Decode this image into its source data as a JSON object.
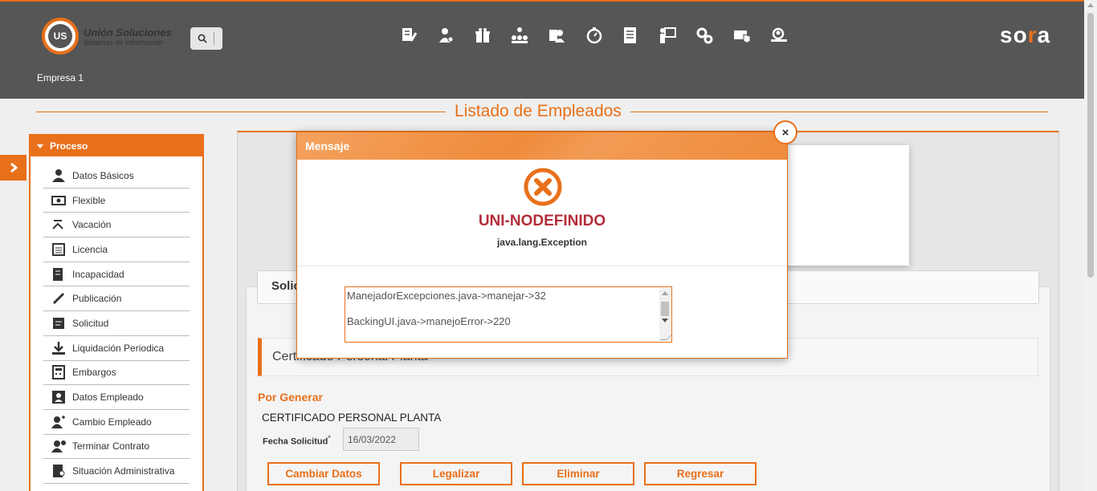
{
  "header": {
    "logo_title": "Unión Soluciones",
    "logo_subtitle": "Sistemas de Información",
    "logo_mark": "US",
    "brand": "sora",
    "empresa": "Empresa 1",
    "nav_icons": [
      "document-edit-icon",
      "user-money-icon",
      "gift-icon",
      "org-chart-icon",
      "user-badge-icon",
      "stopwatch-icon",
      "document-list-icon",
      "presentation-icon",
      "gears-icon",
      "shield-check-icon",
      "user-search-icon"
    ]
  },
  "page": {
    "title": "Listado de Empleados"
  },
  "sidebar": {
    "header": "Proceso",
    "items": [
      {
        "label": "Datos Básicos",
        "icon": "user-icon"
      },
      {
        "label": "Flexible",
        "icon": "money-icon"
      },
      {
        "label": "Vacación",
        "icon": "beach-chair-icon"
      },
      {
        "label": "Licencia",
        "icon": "calendar-list-icon"
      },
      {
        "label": "Incapacidad",
        "icon": "medical-doc-icon"
      },
      {
        "label": "Publicación",
        "icon": "pencil-icon"
      },
      {
        "label": "Solicitud",
        "icon": "doc-icon"
      },
      {
        "label": "Liquidación Periodica",
        "icon": "download-icon"
      },
      {
        "label": "Embargos",
        "icon": "calculator-icon"
      },
      {
        "label": "Datos Empleado",
        "icon": "id-card-icon"
      },
      {
        "label": "Cambio Empleado",
        "icon": "user-change-icon"
      },
      {
        "label": "Terminar Contrato",
        "icon": "user-remove-icon"
      },
      {
        "label": "Situación Administrativa",
        "icon": "doc-user-icon"
      }
    ]
  },
  "main": {
    "soli_label": "Solic",
    "certificate_bar": "Certificado Personal Planta",
    "section_title": "Por Generar",
    "certificate_title": "CERTIFICADO PERSONAL PLANTA",
    "fecha_label": "Fecha Solicitud",
    "fecha_required": "*",
    "fecha_value": "16/03/2022",
    "buttons": {
      "cambiar": "Cambiar Datos",
      "legalizar": "Legalizar",
      "eliminar": "Eliminar",
      "regresar": "Regresar"
    }
  },
  "modal": {
    "title": "Mensaje",
    "close_symbol": "×",
    "error_code": "UNI-NODEFINIDO",
    "error_type": "java.lang.Exception",
    "stack": [
      "ManejadorExcepciones.java->manejar->32",
      "BackingUI.java->manejoError->220"
    ]
  },
  "colors": {
    "accent": "#e8701a",
    "header_bg": "#565656",
    "error_red": "#b22d3a"
  }
}
